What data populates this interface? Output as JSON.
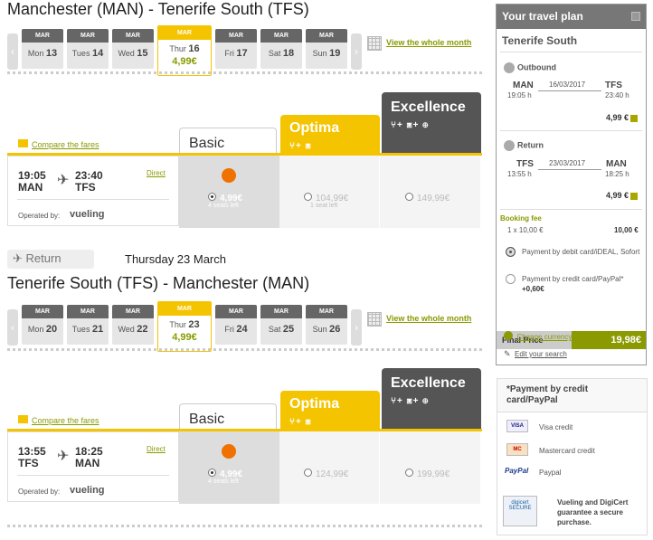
{
  "outbound": {
    "title": "Manchester (MAN) - Tenerife South (TFS)",
    "days": [
      {
        "mon": "MAR",
        "day": "Mon",
        "num": "13"
      },
      {
        "mon": "MAR",
        "day": "Tues",
        "num": "14"
      },
      {
        "mon": "MAR",
        "day": "Wed",
        "num": "15"
      },
      {
        "mon": "MAR",
        "day": "Thur",
        "num": "16",
        "price": "4,99€"
      },
      {
        "mon": "MAR",
        "day": "Fri",
        "num": "17"
      },
      {
        "mon": "MAR",
        "day": "Sat",
        "num": "18"
      },
      {
        "mon": "MAR",
        "day": "Sun",
        "num": "19"
      }
    ],
    "whole_month": "View the whole month",
    "compare": "Compare the fares",
    "fares": {
      "basic": "Basic",
      "optima": "Optima",
      "excellence": "Excellence"
    },
    "flight": {
      "dep_time": "19:05",
      "dep_code": "MAN",
      "arr_time": "23:40",
      "arr_code": "TFS",
      "direct": "Direct",
      "operated": "Operated by:",
      "carrier": "vueling"
    },
    "prices": {
      "basic": "4,99€",
      "basic_seats": "4 seats left",
      "optima": "104,99€",
      "optima_seats": "1 seat left",
      "excellence": "149,99€"
    }
  },
  "return": {
    "chip": "Return",
    "date": "Thursday 23 March",
    "title": "Tenerife South (TFS) - Manchester (MAN)",
    "days": [
      {
        "mon": "MAR",
        "day": "Mon",
        "num": "20"
      },
      {
        "mon": "MAR",
        "day": "Tues",
        "num": "21"
      },
      {
        "mon": "MAR",
        "day": "Wed",
        "num": "22"
      },
      {
        "mon": "MAR",
        "day": "Thur",
        "num": "23",
        "price": "4,99€"
      },
      {
        "mon": "MAR",
        "day": "Fri",
        "num": "24"
      },
      {
        "mon": "MAR",
        "day": "Sat",
        "num": "25"
      },
      {
        "mon": "MAR",
        "day": "Sun",
        "num": "26"
      }
    ],
    "whole_month": "View the whole month",
    "compare": "Compare the fares",
    "fares": {
      "basic": "Basic",
      "optima": "Optima",
      "excellence": "Excellence"
    },
    "flight": {
      "dep_time": "13:55",
      "dep_code": "TFS",
      "arr_time": "18:25",
      "arr_code": "MAN",
      "direct": "Direct",
      "operated": "Operated by:",
      "carrier": "vueling"
    },
    "prices": {
      "basic": "4,99€",
      "basic_seats": "4 seats left",
      "optima": "124,99€",
      "excellence": "199,99€"
    }
  },
  "plan": {
    "title": "Your travel plan",
    "dest": "Tenerife South",
    "out": {
      "label": "Outbound",
      "from": "MAN",
      "to": "TFS",
      "date": "16/03/2017",
      "dep": "19:05 h",
      "arr": "23:40 h",
      "price": "4,99 €"
    },
    "ret": {
      "label": "Return",
      "from": "TFS",
      "to": "MAN",
      "date": "23/03/2017",
      "dep": "13:55 h",
      "arr": "18:25 h",
      "price": "4,99 €"
    },
    "fee_label": "Booking fee",
    "fee_qty": "1 x 10,00 €",
    "fee_total": "10,00 €",
    "pay_debit": "Payment by debit card/iDEAL, Sofort",
    "pay_credit": "Payment by credit card/PayPal*",
    "pay_credit_extra": "+0,60€",
    "final_label": "Final Price",
    "final_value": "19,98€",
    "change_currency": "Change currency",
    "edit_search": "Edit your search"
  },
  "credit": {
    "title": "*Payment by credit card/PayPal",
    "items": [
      {
        "icon": "VISA",
        "label": "Visa credit"
      },
      {
        "icon": "MC",
        "label": "Mastercard credit"
      },
      {
        "icon": "PayPal",
        "label": "Paypal"
      }
    ],
    "secure_text": "Vueling and DigiCert guarantee a secure purchase.",
    "badge": "digicert SECURE"
  }
}
